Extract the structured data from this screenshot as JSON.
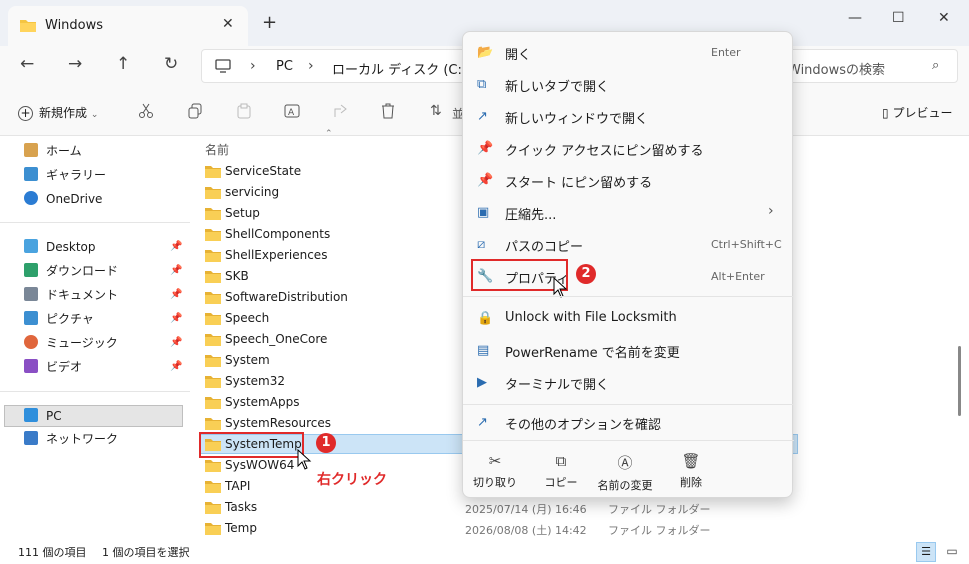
{
  "window": {
    "tab_title": "Windows",
    "new_tab": "+",
    "minimize": "—",
    "maximize": "☐",
    "close": "✕"
  },
  "address": {
    "crumbs": [
      "PC",
      "ローカル ディスク (C:)"
    ],
    "search_placeholder": "Windowsの検索"
  },
  "toolbar": {
    "new_label": "新規作成",
    "preview_label": "プレビュー",
    "sort_label": "並"
  },
  "sidebar": {
    "items": [
      {
        "label": "ホーム"
      },
      {
        "label": "ギャラリー"
      },
      {
        "label": "OneDrive"
      },
      {
        "label": "Desktop"
      },
      {
        "label": "ダウンロード"
      },
      {
        "label": "ドキュメント"
      },
      {
        "label": "ピクチャ"
      },
      {
        "label": "ミュージック"
      },
      {
        "label": "ビデオ"
      },
      {
        "label": "PC"
      },
      {
        "label": "ネットワーク"
      }
    ]
  },
  "list": {
    "column_name": "名前",
    "rows": [
      "ServiceState",
      "servicing",
      "Setup",
      "ShellComponents",
      "ShellExperiences",
      "SKB",
      "SoftwareDistribution",
      "Speech",
      "Speech_OneCore",
      "System",
      "System32",
      "SystemApps",
      "SystemResources",
      "SystemTemp",
      "SysWOW64",
      "TAPI",
      "Tasks",
      "Temp"
    ],
    "meta": [
      {
        "date": "2025/07/14 (月) 16:46",
        "type": "ファイル フォルダー"
      },
      {
        "date": "2026/08/08 (土) 14:42",
        "type": "ファイル フォルダー"
      }
    ]
  },
  "status": {
    "count": "111 個の項目",
    "selected": "1 個の項目を選択"
  },
  "context_menu": {
    "items": [
      {
        "label": "開く",
        "key": "Enter"
      },
      {
        "label": "新しいタブで開く",
        "key": ""
      },
      {
        "label": "新しいウィンドウで開く",
        "key": ""
      },
      {
        "label": "クイック アクセスにピン留めする",
        "key": ""
      },
      {
        "label": "スタート にピン留めする",
        "key": ""
      },
      {
        "label": "圧縮先...",
        "key": ""
      },
      {
        "label": "パスのコピー",
        "key": "Ctrl+Shift+C"
      },
      {
        "label": "プロパティ",
        "key": "Alt+Enter"
      },
      {
        "label": "Unlock with File Locksmith",
        "key": ""
      },
      {
        "label": "PowerRename で名前を変更",
        "key": ""
      },
      {
        "label": "ターミナルで開く",
        "key": ""
      },
      {
        "label": "その他のオプションを確認",
        "key": ""
      }
    ],
    "bottom": [
      {
        "label": "切り取り"
      },
      {
        "label": "コピー"
      },
      {
        "label": "名前の変更"
      },
      {
        "label": "削除"
      }
    ]
  },
  "annotations": {
    "badge1": "1",
    "badge2": "2",
    "right_click": "右クリック"
  },
  "colors": {
    "accent_red": "#e02a2a",
    "selection": "#cce4f7",
    "folder": "#f5c542"
  }
}
